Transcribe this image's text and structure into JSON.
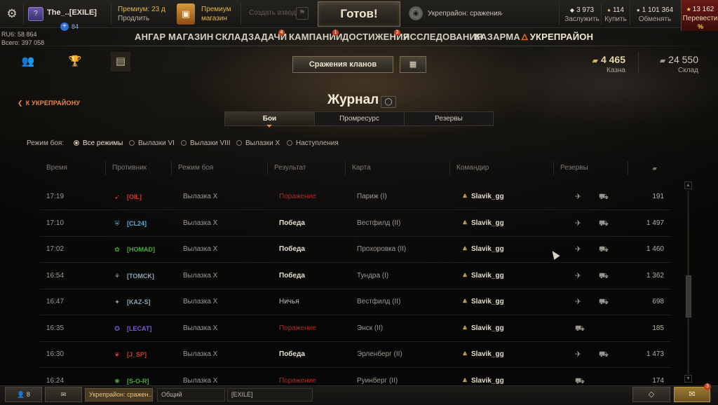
{
  "top": {
    "player_name": "The_..[EXILE]",
    "plus_count": "84",
    "rating_line": "RU6: 58 864",
    "total_line": "Всего: 397 058",
    "premium_days": "Премиум: 23 д",
    "premium_extend": "Продлить",
    "shop_line1": "Премиум",
    "shop_line2": "магазин",
    "create_platoon": "Создать взвод",
    "ready": "Готов!",
    "mode": "Укрепрайон: сражения",
    "resources": [
      {
        "value": "3 973",
        "label": "Заслужить"
      },
      {
        "value": "114",
        "label": "Купить"
      },
      {
        "value": "1 101 364",
        "label": "Обменять"
      }
    ],
    "convert_value": "13 162",
    "convert_label": "Перевести",
    "convert_pct": "%"
  },
  "nav": [
    {
      "label": "АНГАР",
      "counter": ""
    },
    {
      "label": "МАГАЗИН",
      "counter": ""
    },
    {
      "label": "СКЛАД",
      "counter": ""
    },
    {
      "label": "ЗАДАЧИ",
      "counter": "4"
    },
    {
      "label": "КАМПАНИИ",
      "counter": "1"
    },
    {
      "label": "ДОСТИЖЕНИЯ",
      "counter": "3"
    },
    {
      "label": "ИССЛЕДОВАНИЯ",
      "counter": ""
    },
    {
      "label": "КАЗАРМА",
      "counter": ""
    },
    {
      "label": "УКРЕПРАЙОН",
      "counter": ""
    }
  ],
  "secondary": {
    "clan_battles": "Сражения кланов",
    "bank_value": "4 465",
    "bank_label": "Казна",
    "store_value": "24 550",
    "store_label": "Склад"
  },
  "back_link": "К УКРЕПРАЙОНУ",
  "title": "Журнал",
  "subtabs": [
    "Бои",
    "Промресурс",
    "Резервы"
  ],
  "filter": {
    "label": "Режим боя:",
    "options": [
      "Все режимы",
      "Вылазки VI",
      "Вылазки VIII",
      "Вылазки X",
      "Наступления"
    ]
  },
  "columns": [
    "Время",
    "Противник",
    "Режим боя",
    "Результат",
    "Карта",
    "Командир",
    "Резервы"
  ],
  "rows": [
    {
      "time": "17:19",
      "clan": "[OIL]",
      "clan_color": "#d43a2a",
      "mode": "Вылазка X",
      "result": "Поражение",
      "result_type": "lose",
      "map": "Париж (I)",
      "commander": "Slavik_gg",
      "reserves": 2,
      "value": "191"
    },
    {
      "time": "17:10",
      "clan": "[CL24]",
      "clan_color": "#5ab0e0",
      "mode": "Вылазка X",
      "result": "Победа",
      "result_type": "win",
      "map": "Вестфилд (II)",
      "commander": "Slavik_gg",
      "reserves": 2,
      "value": "1 497"
    },
    {
      "time": "17:02",
      "clan": "[HOMAD]",
      "clan_color": "#4aa83a",
      "mode": "Вылазка X",
      "result": "Победа",
      "result_type": "win",
      "map": "Прохоровка (II)",
      "commander": "Slavik_gg",
      "reserves": 2,
      "value": "1 460"
    },
    {
      "time": "16:54",
      "clan": "[TOMCK]",
      "clan_color": "#8aa6b8",
      "mode": "Вылазка X",
      "result": "Победа",
      "result_type": "win",
      "map": "Тундра (I)",
      "commander": "Slavik_gg",
      "reserves": 2,
      "value": "1 362"
    },
    {
      "time": "16:47",
      "clan": "[KAZ-S]",
      "clan_color": "#8aa6b8",
      "mode": "Вылазка X",
      "result": "Ничья",
      "result_type": "draw",
      "map": "Вестфилд (II)",
      "commander": "Slavik_gg",
      "reserves": 2,
      "value": "698"
    },
    {
      "time": "16:35",
      "clan": "[LECAT]",
      "clan_color": "#7a5ad0",
      "mode": "Вылазка X",
      "result": "Поражение",
      "result_type": "lose",
      "map": "Энск (II)",
      "commander": "Slavik_gg",
      "reserves": 1,
      "value": "185"
    },
    {
      "time": "16:30",
      "clan": "[J_SP]",
      "clan_color": "#d43a2a",
      "mode": "Вылазка X",
      "result": "Победа",
      "result_type": "win",
      "map": "Эрленберг (II)",
      "commander": "Slavik_gg",
      "reserves": 2,
      "value": "1 473"
    },
    {
      "time": "16:24",
      "clan": "[S-O-R]",
      "clan_color": "#4aa83a",
      "mode": "Вылазка X",
      "result": "Поражение",
      "result_type": "lose",
      "map": "Руинберг (II)",
      "commander": "Slavik_gg",
      "reserves": 1,
      "value": "174"
    }
  ],
  "bottom": {
    "friends_count": "8",
    "channels": [
      "Укрепрайон: сражен...",
      "Общий",
      "[EXILE]"
    ],
    "notif_count": "3"
  },
  "colors": {
    "accent": "#e78a4a",
    "lose": "#b6291f",
    "gold": "#d8b55a"
  }
}
